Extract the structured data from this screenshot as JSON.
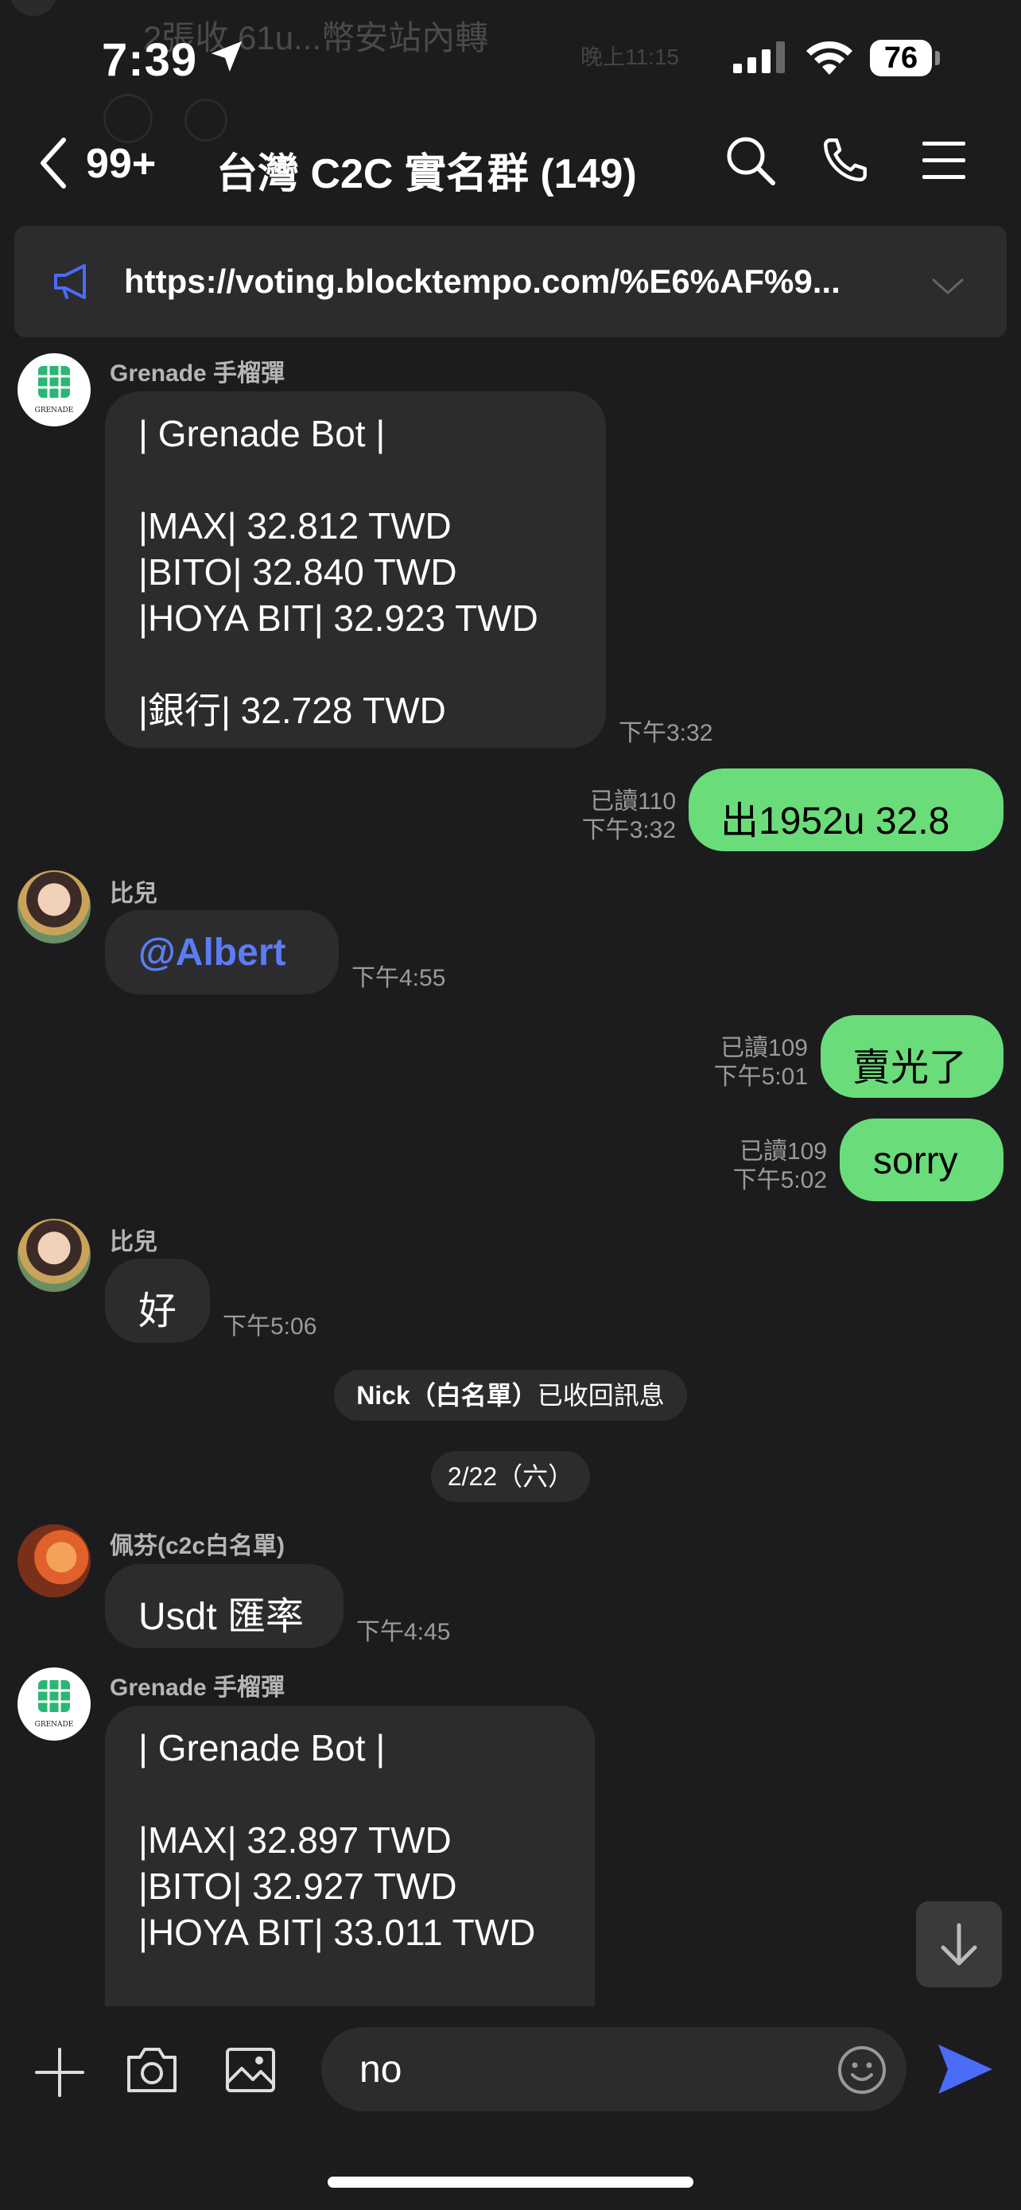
{
  "notification_ghost": {
    "text": "2張收 61u...幣安站內轉",
    "time": "晚上11:15"
  },
  "status_bar": {
    "time": "7:39",
    "battery": "76"
  },
  "header": {
    "back_count": "99+",
    "title": "台灣 C2C 實名群 (149)"
  },
  "announcement": {
    "text": "https://voting.blocktempo.com/%E6%AF%9..."
  },
  "messages": [
    {
      "type": "incoming",
      "sender": "Grenade 手榴彈",
      "avatar_logo": "GRENADE",
      "text": "| Grenade Bot |\n\n|MAX| 32.812 TWD\n|BITO| 32.840 TWD\n|HOYA BIT| 32.923 TWD\n\n|銀行| 32.728 TWD",
      "time": "下午3:32"
    },
    {
      "type": "outgoing",
      "text": "出1952u 32.8",
      "read": "已讀110",
      "time": "下午3:32"
    },
    {
      "type": "incoming",
      "sender": "比兒",
      "text": "@Albert",
      "time": "下午4:55"
    },
    {
      "type": "outgoing",
      "text": "賣光了",
      "read": "已讀109",
      "time": "下午5:01"
    },
    {
      "type": "outgoing",
      "text": "sorry",
      "read": "已讀109",
      "time": "下午5:02"
    },
    {
      "type": "incoming",
      "sender": "比兒",
      "text": "好",
      "time": "下午5:06"
    },
    {
      "type": "system",
      "text_bold": "Nick（白名單）",
      "text_rest": "已收回訊息"
    },
    {
      "type": "date",
      "text": "2/22（六）"
    },
    {
      "type": "incoming",
      "sender": "佩芬(c2c白名單)",
      "text": "Usdt 匯率",
      "time": "下午4:45"
    },
    {
      "type": "incoming",
      "sender": "Grenade 手榴彈",
      "avatar_logo": "GRENADE",
      "text": "| Grenade Bot |\n\n|MAX| 32.897 TWD\n|BITO| 32.927 TWD\n|HOYA BIT| 33.011 TWD"
    }
  ],
  "input": {
    "value": "no"
  },
  "colors": {
    "background": "#1c1c1e",
    "bubble_incoming": "#2c2c2e",
    "bubble_outgoing": "#6bdc7a",
    "mention": "#5b7cf5",
    "send": "#4a6cf7"
  }
}
